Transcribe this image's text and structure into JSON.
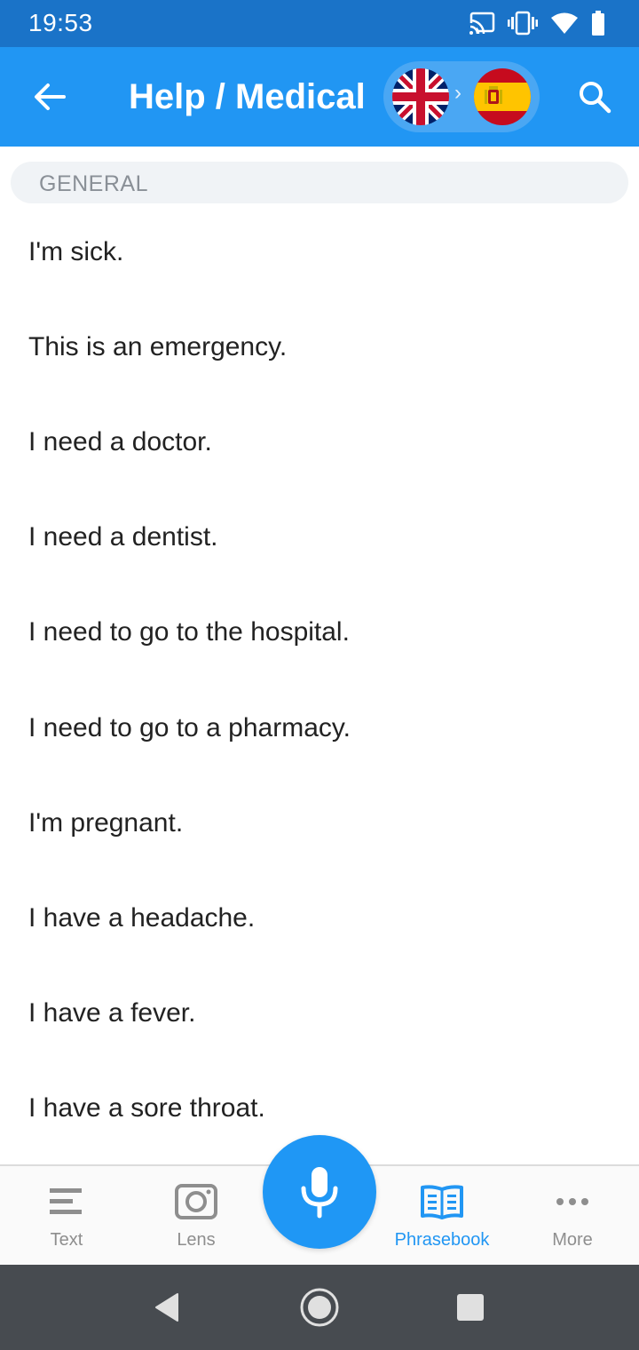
{
  "status_bar": {
    "time": "19:53"
  },
  "app_bar": {
    "title": "Help / Medical",
    "source_language": "English (UK)",
    "target_language": "Spanish",
    "arrow": "›"
  },
  "section": {
    "label": "GENERAL"
  },
  "phrases": [
    "I'm sick.",
    "This is an emergency.",
    "I need a doctor.",
    "I need a dentist.",
    "I need to go to the hospital.",
    "I need to go to a pharmacy.",
    "I'm pregnant.",
    "I have a headache.",
    "I have a fever.",
    "I have a sore throat."
  ],
  "bottom_nav": {
    "items": [
      {
        "label": "Text",
        "icon": "text-lines-icon"
      },
      {
        "label": "Lens",
        "icon": "camera-icon"
      },
      {
        "label": "Phrasebook",
        "icon": "book-icon",
        "active": true
      },
      {
        "label": "More",
        "icon": "more-dots-icon"
      }
    ],
    "mic_icon": "microphone-icon"
  },
  "colors": {
    "status_bar": "#1a73c8",
    "app_bar": "#2196f3",
    "accent": "#2196f3",
    "system_nav": "#474b50"
  }
}
